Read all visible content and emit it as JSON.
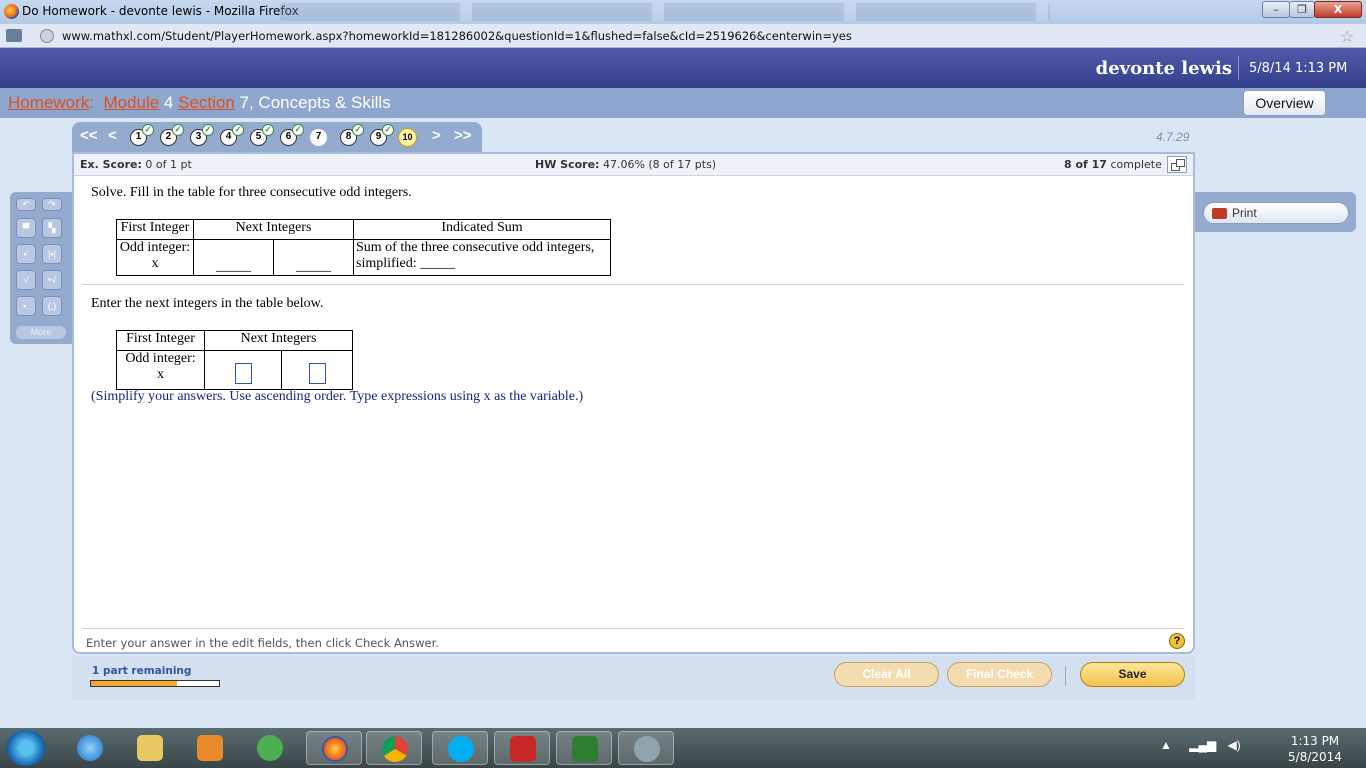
{
  "window": {
    "title": "Do Homework - devonte lewis - Mozilla Firefox",
    "minimize_label": "–",
    "maximize_label": "❐",
    "close_label": "X"
  },
  "address": {
    "url": "www.mathxl.com/Student/PlayerHomework.aspx?homeworkId=181286002&questionId=1&flushed=false&cId=2519626&centerwin=yes",
    "star": "☆"
  },
  "header": {
    "user": "devonte lewis",
    "datetime": "5/8/14 1:13 PM"
  },
  "breadcrumb": {
    "homework": "Homework",
    "colon": ":",
    "module": "Module",
    "module_num": " 4 ",
    "section": "Section",
    "section_rest": " 7, Concepts & Skills",
    "overview_label": "Overview"
  },
  "qnav": {
    "first": "<<",
    "prev": "<",
    "next": ">",
    "last": ">>",
    "questions": [
      {
        "n": "1",
        "done": true
      },
      {
        "n": "2",
        "done": true
      },
      {
        "n": "3",
        "done": true
      },
      {
        "n": "4",
        "done": true
      },
      {
        "n": "5",
        "done": true
      },
      {
        "n": "6",
        "done": true
      },
      {
        "n": "7",
        "done": false,
        "current": true
      },
      {
        "n": "8",
        "done": true
      },
      {
        "n": "9",
        "done": true
      },
      {
        "n": "10",
        "done": false,
        "partial": true
      }
    ],
    "check": "✓",
    "question_id": "4.7.29"
  },
  "score": {
    "ex_label": "Ex. Score:",
    "ex_value": "0 of 1 pt",
    "hw_label": "HW Score:",
    "hw_value": "47.06% (8 of 17 pts)",
    "progress_count": "8 of 17",
    "progress_word": "complete"
  },
  "question": {
    "prompt1": "Solve. Fill in the table for three consecutive odd integers.",
    "table1": {
      "h1": "First Integer",
      "h2": "Next Integers",
      "h3": "Indicated Sum",
      "c1a": "Odd integer:",
      "c1b": "x",
      "c2": "_____",
      "c3": "_____",
      "c4a": "Sum of the three consecutive odd integers,",
      "c4b": "simplified: _____"
    },
    "prompt2": "Enter the next integers in the table below.",
    "table2": {
      "h1": "First Integer",
      "h2": "Next Integers",
      "c1a": "Odd integer:",
      "c1b": "x"
    },
    "hint": "(Simplify your answers. Use ascending order. Type expressions using x as the variable.)"
  },
  "footer": {
    "instruction": "Enter your answer in the edit fields, then click Check Answer.",
    "help": "?"
  },
  "palette": {
    "more_label": "More"
  },
  "print": {
    "label": "Print"
  },
  "bottom": {
    "parts_remaining": "1 part remaining",
    "progress_fraction": 0.67,
    "clear_all": "Clear All",
    "final_check": "Final Check",
    "save": "Save"
  },
  "taskbar": {
    "clock_time": "1:13 PM",
    "clock_date": "5/8/2014"
  },
  "colors": {
    "accent_orange": "#e0501e",
    "header_blue": "#3b4796",
    "nav_blue": "#95aacf"
  }
}
